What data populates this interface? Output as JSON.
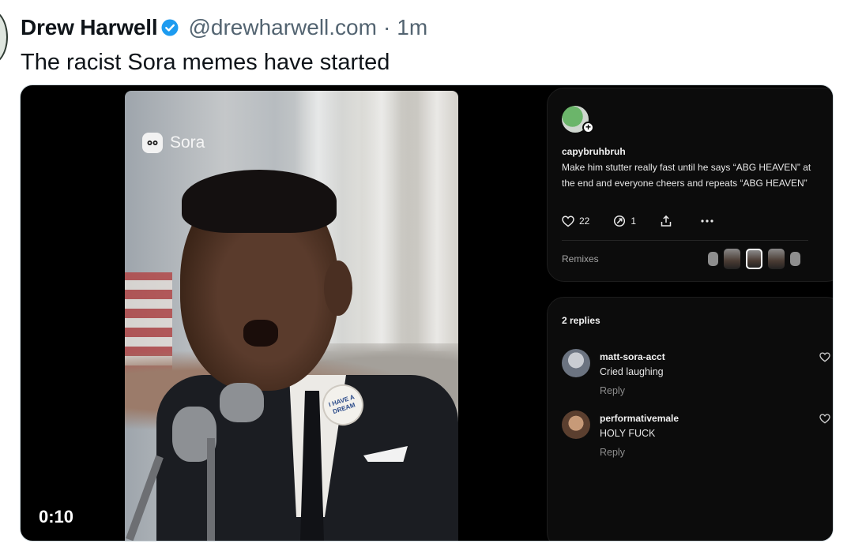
{
  "tweet": {
    "author_name": "Drew Harwell",
    "handle": "@drewharwell.com",
    "separator": "·",
    "time_ago": "1m",
    "text": "The racist Sora memes have started"
  },
  "video": {
    "watermark": "Sora",
    "timecode": "0:10",
    "pin_text": "I HAVE A DREAM"
  },
  "post": {
    "username": "capybruhbruh",
    "caption": "Make him stutter really fast until he says “ABG HEAVEN” at the end and everyone cheers and repeats “ABG HEAVEN”",
    "likes": "22",
    "remix_count": "1",
    "remixes_label": "Remixes"
  },
  "replies": {
    "title": "2 replies",
    "items": [
      {
        "username": "matt-sora-acct",
        "text": "Cried laughing",
        "reply_label": "Reply"
      },
      {
        "username": "performativemale",
        "text": "HOLY FUCK",
        "reply_label": "Reply"
      }
    ]
  },
  "colors": {
    "verified": "#1d9bf0",
    "secondary_text": "#536471",
    "panel_bg": "#0c0c0c"
  }
}
